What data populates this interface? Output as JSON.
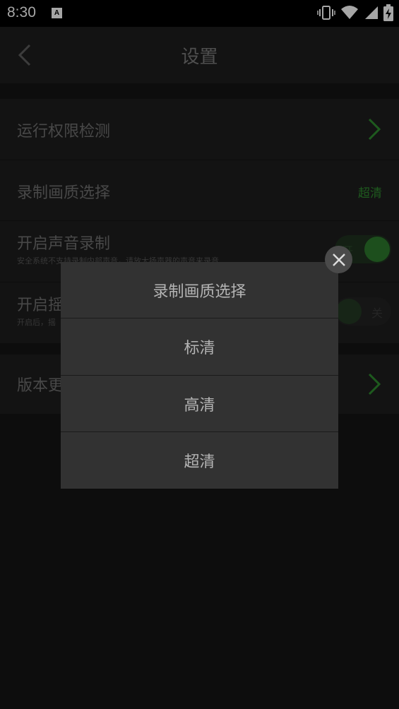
{
  "status_bar": {
    "time": "8:30",
    "notification_icon_letter": "A",
    "icons": [
      "vibrate-icon",
      "wifi-icon",
      "signal-icon",
      "battery-charging-icon"
    ]
  },
  "header": {
    "title": "设置",
    "back_icon": "chevron-left-icon"
  },
  "settings": [
    {
      "label": "运行权限检测",
      "control": "chevron"
    },
    {
      "label": "录制画质选择",
      "value": "超清"
    },
    {
      "label": "开启声音录制",
      "subtitle": "安全系统不支持录制内部声音，请放大扬声器的声音来录音",
      "toggle_text": "开",
      "toggle_state": "on"
    },
    {
      "label": "开启摇",
      "subtitle": "开启后，摇",
      "toggle_text": "关",
      "toggle_state": "off"
    },
    {
      "label": "版本更",
      "control": "chevron"
    }
  ],
  "dialog": {
    "title": "录制画质选择",
    "options": [
      "标清",
      "高清",
      "超清"
    ],
    "close_icon": "close-icon"
  },
  "colors": {
    "accent": "#2f8a2f",
    "background": "#141414",
    "row_background": "#1e1e1e",
    "dialog_background": "#323232"
  }
}
